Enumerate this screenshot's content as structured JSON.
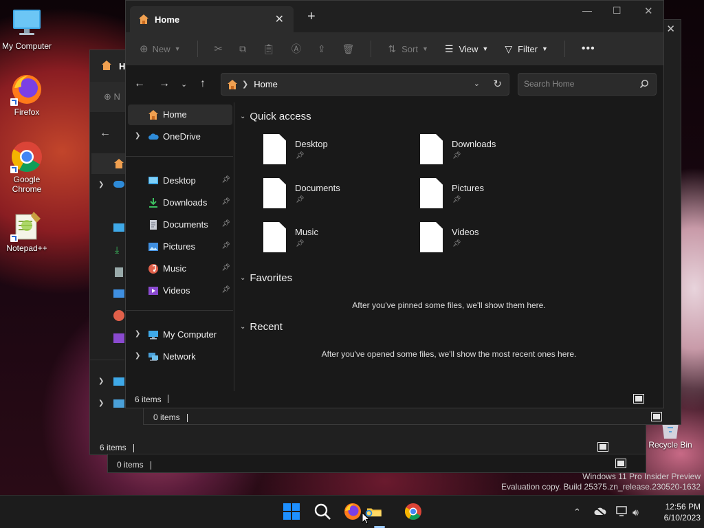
{
  "desktop": {
    "icons": [
      {
        "label": "My Computer"
      },
      {
        "label": "Firefox"
      },
      {
        "label": "Google\nChrome"
      },
      {
        "label": "Notepad++"
      },
      {
        "label": "Recycle Bin"
      }
    ],
    "watermark": {
      "line1": "Windows 11 Pro Insider Preview",
      "line2": "Evaluation copy. Build 25375.zn_release.230520-1632"
    }
  },
  "background_windows": {
    "win1": {
      "tab_title_fragment": "H",
      "toolbar_fragment": "N",
      "status": "6 items"
    },
    "win2": {
      "status": "0 items"
    },
    "win3": {
      "status": "0 items"
    }
  },
  "window": {
    "tab_title": "Home",
    "toolbar": {
      "new_label": "New",
      "sort_label": "Sort",
      "view_label": "View",
      "filter_label": "Filter"
    },
    "address": {
      "path_label": "Home",
      "search_placeholder": "Search Home"
    },
    "sidebar": {
      "home": "Home",
      "onedrive": "OneDrive",
      "pinned": [
        {
          "label": "Desktop"
        },
        {
          "label": "Downloads"
        },
        {
          "label": "Documents"
        },
        {
          "label": "Pictures"
        },
        {
          "label": "Music"
        },
        {
          "label": "Videos"
        }
      ],
      "my_computer": "My Computer",
      "network": "Network"
    },
    "content": {
      "quick_access_title": "Quick access",
      "quick_access_items": [
        {
          "label": "Desktop"
        },
        {
          "label": "Downloads"
        },
        {
          "label": "Documents"
        },
        {
          "label": "Pictures"
        },
        {
          "label": "Music"
        },
        {
          "label": "Videos"
        }
      ],
      "favorites_title": "Favorites",
      "favorites_empty": "After you've pinned some files, we'll show them here.",
      "recent_title": "Recent",
      "recent_empty": "After you've opened some files, we'll show the most recent ones here."
    },
    "status": "6 items"
  },
  "taskbar": {
    "time": "12:56 PM",
    "date": "6/10/2023"
  },
  "colors": {
    "folder_blue": "#2e8bd8",
    "accent_windows": "#1e90ff",
    "explorer_folder": "#f5c542"
  }
}
